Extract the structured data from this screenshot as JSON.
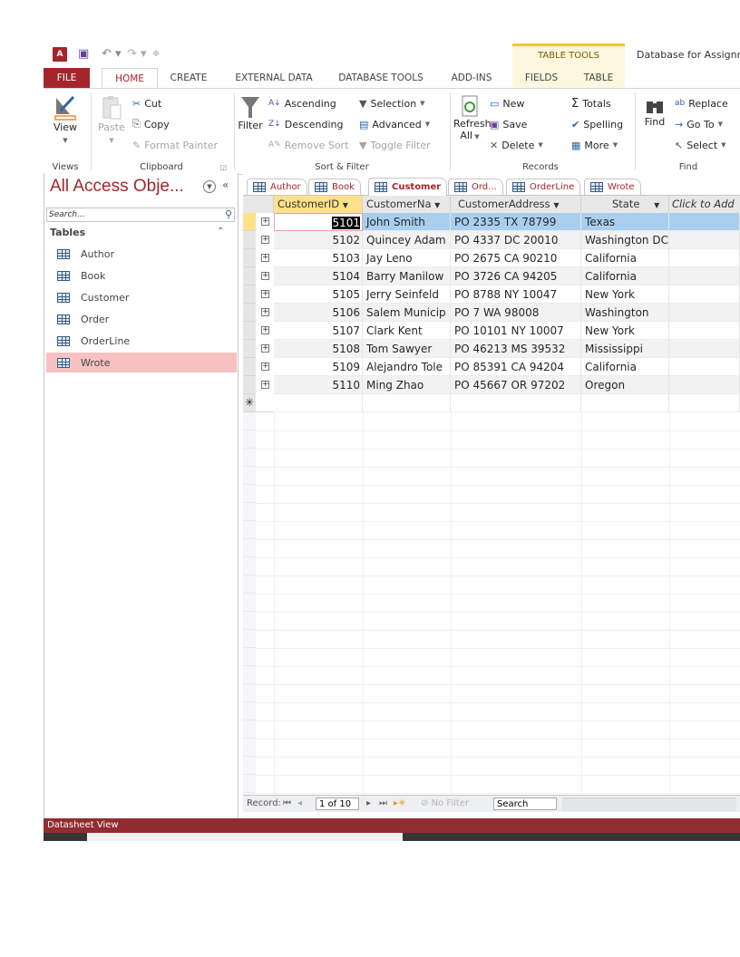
{
  "qat": {
    "app_icon": "access-logo-icon",
    "app_icon_text": "A",
    "save_icon": "save-icon",
    "undo_icon": "undo-icon",
    "redo_icon": "redo-icon",
    "customize_icon": "customize-qat-icon"
  },
  "context_header": "TABLE TOOLS",
  "document_title": "Database for Assignm",
  "tabs": [
    {
      "label": "FILE"
    },
    {
      "label": "HOME",
      "active": true
    },
    {
      "label": "CREATE"
    },
    {
      "label": "EXTERNAL DATA"
    },
    {
      "label": "DATABASE TOOLS"
    },
    {
      "label": "ADD-INS"
    },
    {
      "label": "FIELDS"
    },
    {
      "label": "TABLE"
    }
  ],
  "ribbon": {
    "views": {
      "label": "Views",
      "view_button": "View"
    },
    "clipboard": {
      "label": "Clipboard",
      "paste": "Paste",
      "cut": "Cut",
      "copy": "Copy",
      "format_painter": "Format Painter"
    },
    "sort_filter": {
      "label": "Sort & Filter",
      "filter": "Filter",
      "ascending": "Ascending",
      "descending": "Descending",
      "remove_sort": "Remove Sort",
      "selection": "Selection",
      "advanced": "Advanced",
      "toggle_filter": "Toggle Filter"
    },
    "records": {
      "label": "Records",
      "refresh": "Refresh",
      "refresh_all": "All",
      "new": "New",
      "save": "Save",
      "delete": "Delete",
      "totals": "Totals",
      "spelling": "Spelling",
      "more": "More"
    },
    "find": {
      "label": "Find",
      "find": "Find",
      "replace": "Replace",
      "goto": "Go To",
      "select": "Select"
    }
  },
  "nav": {
    "title": "All Access Obje...",
    "search_placeholder": "Search...",
    "group": "Tables",
    "items": [
      {
        "label": "Author"
      },
      {
        "label": "Book"
      },
      {
        "label": "Customer"
      },
      {
        "label": "Order"
      },
      {
        "label": "OrderLine"
      },
      {
        "label": "Wrote",
        "selected": true
      }
    ]
  },
  "doc_tabs": [
    {
      "label": "Author"
    },
    {
      "label": "Book"
    },
    {
      "label": "Customer",
      "active": true
    },
    {
      "label": "Ord..."
    },
    {
      "label": "OrderLine"
    },
    {
      "label": "Wrote"
    }
  ],
  "table": {
    "columns": [
      {
        "label": "CustomerID"
      },
      {
        "label": "CustomerNa"
      },
      {
        "label": "CustomerAddress"
      },
      {
        "label": "State"
      },
      {
        "label": "Click to Add"
      }
    ],
    "rows": [
      {
        "id": "5101",
        "name": "John Smith",
        "address": "PO 2335 TX 78799",
        "state": "Texas"
      },
      {
        "id": "5102",
        "name": "Quincey Adam",
        "address": "PO 4337 DC 20010",
        "state": "Washington DC"
      },
      {
        "id": "5103",
        "name": "Jay Leno",
        "address": "PO 2675 CA 90210",
        "state": "California"
      },
      {
        "id": "5104",
        "name": "Barry Manilow",
        "address": "PO 3726 CA 94205",
        "state": "California"
      },
      {
        "id": "5105",
        "name": "Jerry Seinfeld",
        "address": "PO 8788 NY 10047",
        "state": "New York"
      },
      {
        "id": "5106",
        "name": "Salem Municip",
        "address": "PO 7 WA 98008",
        "state": "Washington"
      },
      {
        "id": "5107",
        "name": "Clark Kent",
        "address": "PO 10101 NY 10007",
        "state": "New York"
      },
      {
        "id": "5108",
        "name": "Tom Sawyer",
        "address": "PO 46213 MS 39532",
        "state": "Mississippi"
      },
      {
        "id": "5109",
        "name": "Alejandro Tole",
        "address": "PO 85391 CA 94204",
        "state": "California"
      },
      {
        "id": "5110",
        "name": "Ming Zhao",
        "address": "PO 45667 OR 97202",
        "state": "Oregon"
      }
    ],
    "new_row_marker": "✳"
  },
  "record_nav": {
    "label": "Record:",
    "current": "1 of 10",
    "filter": "No Filter",
    "search": "Search"
  },
  "status": {
    "text": "Datasheet View"
  },
  "colors": {
    "accent": "#a4262c",
    "status_bar": "#912c31",
    "selected_nav": "#f7c1c3",
    "current_row": "#a8cff0",
    "selected_header": "#fde18b"
  }
}
